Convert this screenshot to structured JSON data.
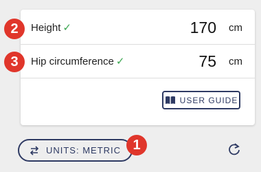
{
  "fields": [
    {
      "label": "Height",
      "value": "170",
      "unit": "cm",
      "valid": true,
      "step": "2"
    },
    {
      "label": "Hip circumference",
      "value": "75",
      "unit": "cm",
      "valid": true,
      "step": "3"
    }
  ],
  "check_glyph": "✓",
  "user_guide": {
    "label": "USER GUIDE",
    "icon": "book-icon"
  },
  "units_button": {
    "label": "UNITS: METRIC",
    "icon": "swap-arrows-icon",
    "step": "1"
  },
  "refresh": {
    "icon": "refresh-icon"
  },
  "colors": {
    "accent": "#2e3a63",
    "badge": "#e0362b",
    "check": "#3aa650"
  }
}
